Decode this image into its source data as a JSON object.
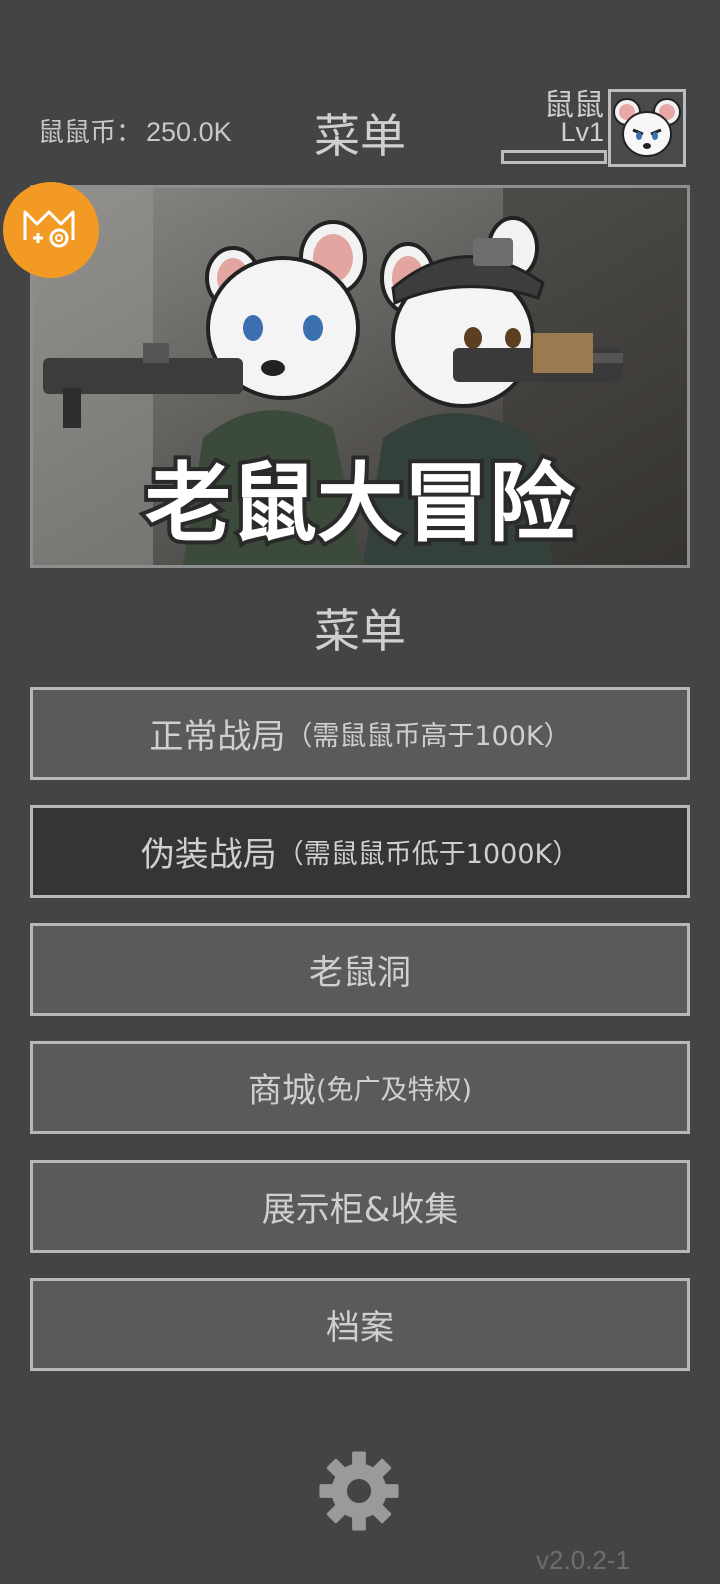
{
  "header": {
    "coin_label": "鼠鼠币：",
    "coin_value": "250.0K",
    "title": "菜单",
    "player_name": "鼠鼠",
    "player_level": "Lv1",
    "xp_progress": 0.0
  },
  "banner": {
    "game_title": "老鼠大冒险"
  },
  "menu": {
    "title": "菜单",
    "buttons": [
      {
        "label": "正常战局",
        "note": "（需鼠鼠币高于100K）"
      },
      {
        "label": "伪装战局",
        "note": "（需鼠鼠币低于1000K）"
      },
      {
        "label": "老鼠洞",
        "note": ""
      },
      {
        "label": "商城",
        "note": "(免广及特权)"
      },
      {
        "label": "展示柜&收集",
        "note": ""
      },
      {
        "label": "档案",
        "note": ""
      }
    ]
  },
  "footer": {
    "version": "v2.0.2-1"
  },
  "colors": {
    "background": "#444444",
    "button_fill": "#5a5a5a",
    "button_fill_active": "#353535",
    "button_border": "#b8b8b8",
    "badge": "#f39a25",
    "text": "#cfcfcf"
  },
  "icons": {
    "settings": "gear-icon",
    "badge": "cat-logo-icon",
    "avatar": "mouse-avatar-icon"
  }
}
